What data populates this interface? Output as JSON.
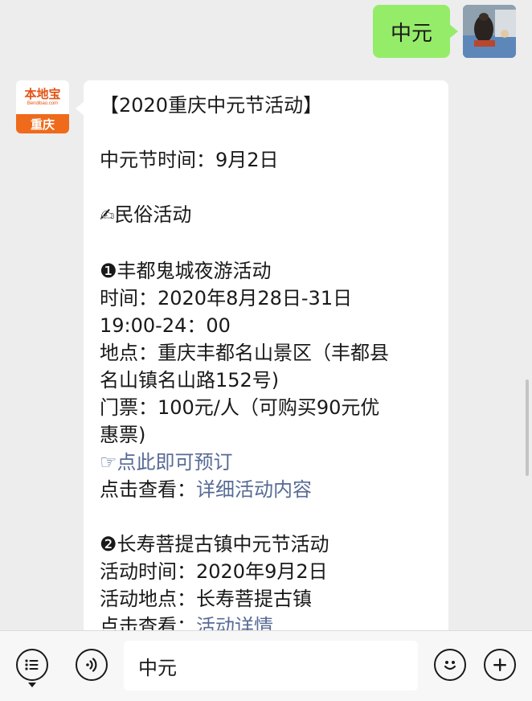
{
  "outgoing_message": {
    "text": "中元"
  },
  "account": {
    "logo_name": "本地宝",
    "logo_url": "Bendibao.com",
    "logo_city": "重庆"
  },
  "incoming_message": {
    "title": "【2020重庆中元节活动】",
    "date_line": "中元节时间：9月2日",
    "section_emoji": "✍",
    "section_title": "民俗活动",
    "event1": {
      "name": "❶丰都鬼城夜游活动",
      "time_line1": "时间：2020年8月28日-31日",
      "time_line2": "19:00-24：00",
      "place_line1": "地点：重庆丰都名山景区（丰都县",
      "place_line2": "名山镇名山路152号)",
      "ticket_line1": "门票：100元/人（可购买90元优",
      "ticket_line2": "惠票)",
      "book_prefix": "☞",
      "book_link": "点此即可预订",
      "detail_label": "点击查看：",
      "detail_link": "详细活动内容"
    },
    "event2": {
      "name": "❷长寿菩提古镇中元节活动",
      "time_line": "活动时间：2020年9月2日",
      "place_line": "活动地点：长寿菩提古镇",
      "detail_label": "点击查看：",
      "detail_link": "活动详情"
    }
  },
  "input_bar": {
    "value": "中元"
  },
  "colors": {
    "chat_background": "#ededed",
    "outgoing_bubble": "#95ec69",
    "link": "#576b95",
    "brand_orange": "#ef6a1a"
  }
}
